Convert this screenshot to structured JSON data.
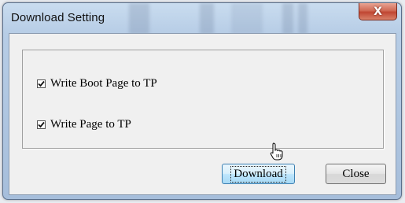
{
  "window": {
    "title": "Download Setting",
    "close_glyph": "X"
  },
  "options": [
    {
      "label": "Write Boot Page to TP",
      "checked": true
    },
    {
      "label": "Write Page to TP",
      "checked": true
    }
  ],
  "buttons": {
    "download_label": "Download",
    "close_label": "Close"
  },
  "icons": {
    "checkmark": "checkmark-icon",
    "cursor": "hand-cursor-icon",
    "close": "close-icon"
  },
  "colors": {
    "title_bar": "#b7cde6",
    "close_button": "#c04632",
    "client_bg": "#f0f0f0",
    "default_button_border": "#3c7fb1"
  }
}
